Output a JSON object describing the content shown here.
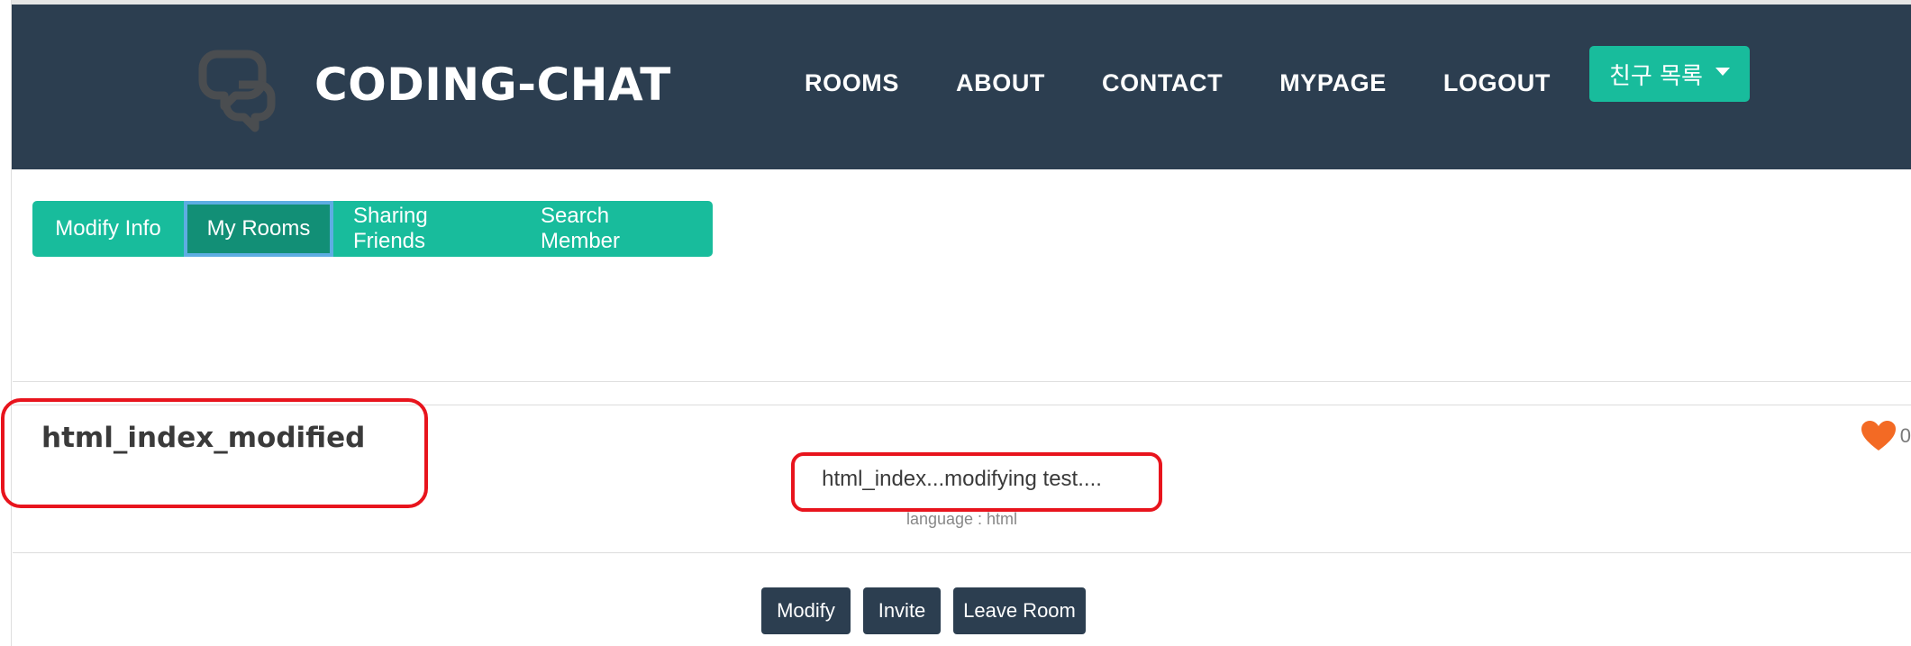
{
  "navbar": {
    "brand": "CODING-CHAT",
    "brand_icon": "chat-bubbles-icon",
    "links": [
      "ROOMS",
      "ABOUT",
      "CONTACT",
      "MYPAGE",
      "LOGOUT"
    ],
    "friends_dropdown": "친구 목록",
    "colors": {
      "navbar_bg": "#2c3e50",
      "accent": "#18bc9c"
    }
  },
  "tabs": [
    "Modify Info",
    "My Rooms",
    "Sharing Friends",
    "Search Member"
  ],
  "active_tab": "My Rooms",
  "room": {
    "title": "html_index_modified",
    "description": "html_index...modifying test....",
    "language_label": "language : html",
    "likes": "0",
    "like_icon": "heart-icon"
  },
  "actions": {
    "modify": "Modify",
    "invite": "Invite",
    "leave": "Leave Room"
  },
  "highlight_color": "#e8141d"
}
